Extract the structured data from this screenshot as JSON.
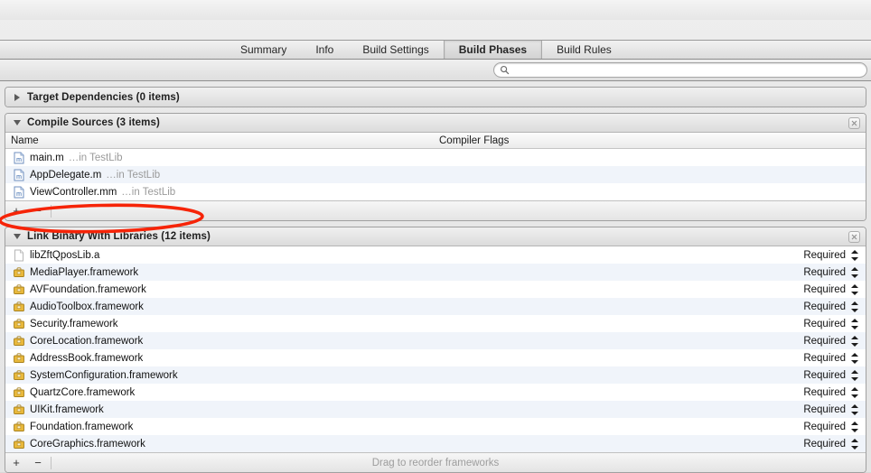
{
  "window": {
    "tabs": [
      {
        "label": "Summary",
        "selected": false
      },
      {
        "label": "Info",
        "selected": false
      },
      {
        "label": "Build Settings",
        "selected": false
      },
      {
        "label": "Build Phases",
        "selected": true
      },
      {
        "label": "Build Rules",
        "selected": false
      }
    ]
  },
  "search": {
    "value": "",
    "placeholder": "",
    "icon": "search-icon"
  },
  "phases": [
    {
      "title": "Target Dependencies (0 items)",
      "expanded": false,
      "has_close": false
    },
    {
      "title": "Compile Sources (3 items)",
      "expanded": true,
      "has_close": true,
      "columns": {
        "name": "Name",
        "flags": "Compiler Flags"
      },
      "rows": [
        {
          "icon": "objc-source-file-icon",
          "name": "main.m",
          "sub": "…in TestLib"
        },
        {
          "icon": "objc-source-file-icon",
          "name": "AppDelegate.m",
          "sub": "…in TestLib"
        },
        {
          "icon": "objcpp-source-file-icon",
          "name": "ViewController.mm",
          "sub": "…in TestLib"
        }
      ],
      "footer": {
        "add": "+",
        "remove": "−",
        "hint": ""
      }
    },
    {
      "title": "Link Binary With Libraries (12 items)",
      "expanded": true,
      "has_close": true,
      "annotated": true,
      "rows": [
        {
          "icon": "static-library-icon",
          "name": "libZftQposLib.a",
          "status": "Required"
        },
        {
          "icon": "framework-icon",
          "name": "MediaPlayer.framework",
          "status": "Required"
        },
        {
          "icon": "framework-icon",
          "name": "AVFoundation.framework",
          "status": "Required"
        },
        {
          "icon": "framework-icon",
          "name": "AudioToolbox.framework",
          "status": "Required"
        },
        {
          "icon": "framework-icon",
          "name": "Security.framework",
          "status": "Required"
        },
        {
          "icon": "framework-icon",
          "name": "CoreLocation.framework",
          "status": "Required"
        },
        {
          "icon": "framework-icon",
          "name": "AddressBook.framework",
          "status": "Required"
        },
        {
          "icon": "framework-icon",
          "name": "SystemConfiguration.framework",
          "status": "Required"
        },
        {
          "icon": "framework-icon",
          "name": "QuartzCore.framework",
          "status": "Required"
        },
        {
          "icon": "framework-icon",
          "name": "UIKit.framework",
          "status": "Required"
        },
        {
          "icon": "framework-icon",
          "name": "Foundation.framework",
          "status": "Required"
        },
        {
          "icon": "framework-icon",
          "name": "CoreGraphics.framework",
          "status": "Required"
        }
      ],
      "footer": {
        "add": "+",
        "remove": "−",
        "hint": "Drag to reorder frameworks"
      }
    }
  ],
  "annotation": {
    "shape": "ellipse",
    "color": "#f62408",
    "target": "Link Binary With Libraries (12 items)"
  },
  "colors": {
    "row_alt": "#f0f4fa",
    "framework_icon": "#e8b83c",
    "annotation_red": "#f62408",
    "muted_text": "#9a9a9a"
  }
}
